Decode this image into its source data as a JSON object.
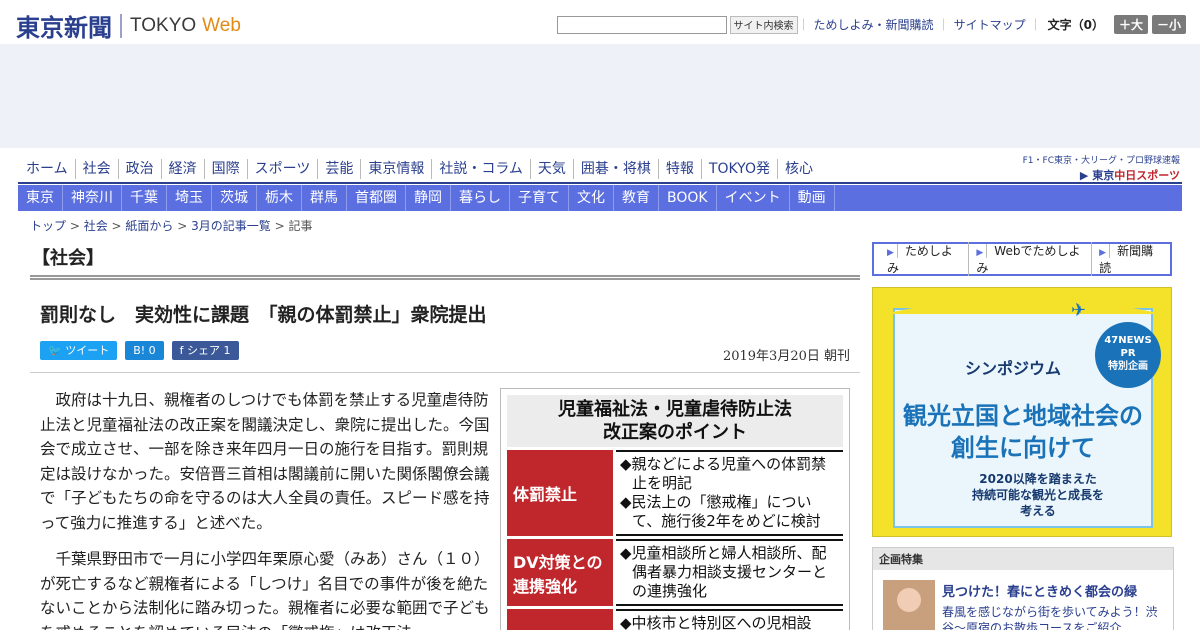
{
  "header": {
    "logo_jp": "東京新聞",
    "logo_en": "TOKYO",
    "logo_web": "Web",
    "search_placeholder": "",
    "search_button": "サイト内検索",
    "links": [
      "ためしよみ・新聞購読",
      "サイトマップ"
    ],
    "font_size_label": "文字（0）",
    "bigger_button": "＋大",
    "smaller_button": "－小"
  },
  "nav_main": [
    "ホーム",
    "社会",
    "政治",
    "経済",
    "国際",
    "スポーツ",
    "芸能",
    "東京情報",
    "社説・コラム",
    "天気",
    "囲碁・将棋",
    "特報",
    "TOKYO発",
    "核心"
  ],
  "chunichi": {
    "top": "F1・FC東京・大リーグ・プロ野球速報",
    "bottom_prefix": "東京",
    "bottom_brand": "中日スポーツ"
  },
  "nav_sub": [
    "東京",
    "神奈川",
    "千葉",
    "埼玉",
    "茨城",
    "栃木",
    "群馬",
    "首都圏",
    "静岡",
    "暮らし",
    "子育て",
    "文化",
    "教育",
    "BOOK",
    "イベント",
    "動画"
  ],
  "breadcrumb": {
    "items": [
      "トップ",
      "社会",
      "紙面から",
      "3月の記事一覧"
    ],
    "sep": " > ",
    "current": "記事"
  },
  "section_title": "【社会】",
  "article": {
    "headline": "罰則なし　実効性に課題　「親の体罰禁止」衆院提出",
    "tweet_label": "ツイート",
    "hatena_label": "B! 0",
    "facebook_label": "シェア 1",
    "date": "2019年3月20日 朝刊",
    "paragraphs": [
      "政府は十九日、親権者のしつけでも体罰を禁止する児童虐待防止法と児童福祉法の改正案を閣議決定し、衆院に提出した。今国会で成立させ、一部を除き来年四月一日の施行を目指す。罰則規定は設けなかった。安倍晋三首相は閣議前に開いた関係閣僚会議で「子どもたちの命を守るのは大人全員の責任。スピード感を持って強力に推進する」と述べた。",
      "千葉県野田市で一月に小学四年栗原心愛（みあ）さん（１０）が死亡するなど親権者による「しつけ」名目での事件が後を絶たないことから法制化に踏み切った。親権者に必要な範囲で子どもを戒めることを認めている民法の「懲戒権」は改正法"
    ]
  },
  "figure": {
    "title_line1": "児童福祉法・児童虐待防止法",
    "title_line2": "改正案のポイント",
    "rows": [
      {
        "head": "体罰禁止",
        "items": [
          "◆親などによる児童への体罰禁止を明記",
          "◆民法上の「懲戒権」について、施行後2年をめどに検討"
        ]
      },
      {
        "head": "DV対策との連携強化",
        "items": [
          "◆児童相談所と婦人相談所、配偶者暴力相談支援センターとの連携強化"
        ]
      },
      {
        "head": "",
        "items": [
          "◆中核市と特別区への児相設"
        ]
      }
    ]
  },
  "sidebar": {
    "links": [
      "ためしよみ",
      "Webでためしよみ",
      "新聞購読"
    ],
    "banner": {
      "badge": [
        "47NEWS",
        "PR",
        "特別企画"
      ],
      "symposium": "シンポジウム",
      "line1": "観光立国と地域社会の",
      "line2": "創生に向けて",
      "sub1": "2020以降を踏まえた",
      "sub2": "持続可能な観光と成長を",
      "sub3": "考える"
    },
    "kikaku": {
      "header": "企画特集",
      "title": "見つけた！春にときめく都会の緑",
      "text": "春風を感じながら街を歩いてみよう！渋谷～原宿のお散歩コースをご紹介"
    }
  }
}
